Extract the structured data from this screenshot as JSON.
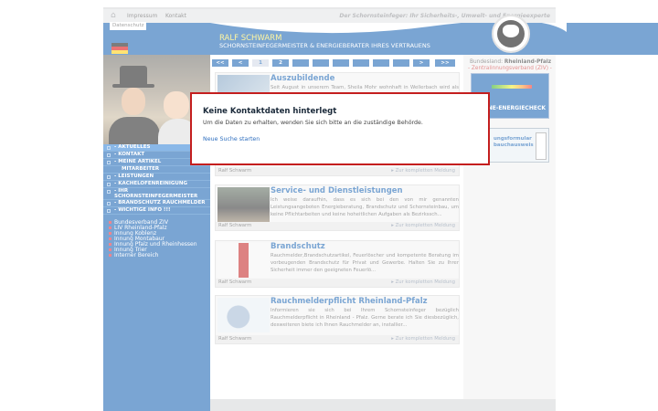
{
  "topnav": {
    "impressum": "Impressum",
    "kontakt": "Kontakt",
    "datenschutz": "Datenschutz",
    "slogan": "Der Schornsteinfeger: Ihr Sicherheits-, Umwelt- und Energieexperte"
  },
  "header": {
    "name": "RALF SCHWARM",
    "subtitle": "SCHORNSTEINFEGERMEISTER & ENERGIEBERATER IHRES VERTRAUENS"
  },
  "menu": [
    {
      "label": "- AKTUELLES"
    },
    {
      "label": "- KONTAKT"
    },
    {
      "label": "- MEINE ARTIKEL"
    },
    {
      "label": "MITARBEITER"
    },
    {
      "label": "- LEISTUNGEN"
    },
    {
      "label": "- KACHELOFENREINIGUNG"
    },
    {
      "label": "- IHR SCHORNSTEINFEGERMEISTER"
    },
    {
      "label": "- BRANDSCHUTZ RAUCHMELDER"
    },
    {
      "label": "- WICHTIGE INFO !!!"
    }
  ],
  "links": [
    "Bundesverband ZIV",
    "LIV Rheinland-Pfalz",
    "Innung Koblenz",
    "Innung Montabaur",
    "Innung Pfalz und Rheinhessen",
    "Innung Trier",
    "Interner Bereich"
  ],
  "pager": {
    "first": "<<",
    "prev": "<",
    "p1": "1",
    "p2": "2",
    "next": ">",
    "last": ">>"
  },
  "articles": [
    {
      "title": "Auszubildende",
      "text": "Seit August in unserem Team, Sheila Mohr wohnhaft in Wellerbach wird als Schornsteinfegerin ausgebildet. Viel Glück und alles Gute für die",
      "author": "Ralf Schwarm",
      "more": "Zur kompletten Meldung"
    },
    {
      "title": "Service- und Dienstleistungen",
      "text": "Ich weise daraufhin, dass es sich bei den von mir genannten Leistungsangeboten Energieberatung, Brandschutz und Schornsteinbau, um keine Pflichtarbeiten und keine hoheitlichen Aufgaben als Bezirkssch...",
      "author": "Ralf Schwarm",
      "more": "Zur kompletten Meldung"
    },
    {
      "title": "Brandschutz",
      "text": "Rauchmelder,Brandschutzartikel, Feuerlöscher und kompetente Beratung im vorbeugenden Brandschutz für Privat und Gewerbe. Halten Sie zu Ihrer Sicherheit immer den geeigneten Feuerlö...",
      "author": "Ralf Schwarm",
      "more": "Zur kompletten Meldung"
    },
    {
      "title": "Rauchmelderpflicht Rheinland-Pfalz",
      "text": "Informieren sie sich bei Ihrem Schornsteinfeger bezüglich Rauchmelderpflicht in Rheinland - Pfalz. Gerne berate ich Sie diesbezüglich, desweiteren biete ich Ihnen Rauchmelder an, installier...",
      "author": "Ralf Schwarm",
      "more": "Zur kompletten Meldung"
    }
  ],
  "right": {
    "bundesland_label": "Bundesland:",
    "bundesland_value": "Rheinland-Pfalz",
    "ziv": "- Zentralinnungsverband (ZIV) -",
    "banner1": "NE-ENERGIECHECK",
    "banner2": "ungsformular\nbauchausweis"
  },
  "modal": {
    "title": "Keine Kontaktdaten hinterlegt",
    "text": "Um die Daten zu erhalten, wenden Sie sich bitte an die zuständige Behörde.",
    "link": "Neue Suche starten"
  }
}
